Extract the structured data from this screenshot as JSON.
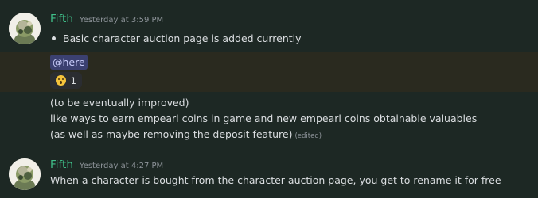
{
  "messages": [
    {
      "username": "Fifth",
      "timestamp": "Yesterday at 3:59 PM",
      "bullet_text": "Basic character auction page is added currently",
      "mention": "@here",
      "reaction": {
        "emoji": "astonished-face",
        "count": "1"
      },
      "lines": [
        "(to be eventually improved)",
        "like ways to earn empearl coins in game and new empearl coins obtainable valuables",
        "(as well as maybe removing the deposit feature)"
      ],
      "edited": "(edited)"
    },
    {
      "username": "Fifth",
      "timestamp": "Yesterday at 4:27 PM",
      "lines": [
        "When a character is bought from the character auction page, you get to rename it for free"
      ]
    }
  ],
  "colors": {
    "background": "#1d2824",
    "username": "#3fbf89",
    "mention_bg": "#3b4070",
    "highlight": "#2a2a1f"
  }
}
